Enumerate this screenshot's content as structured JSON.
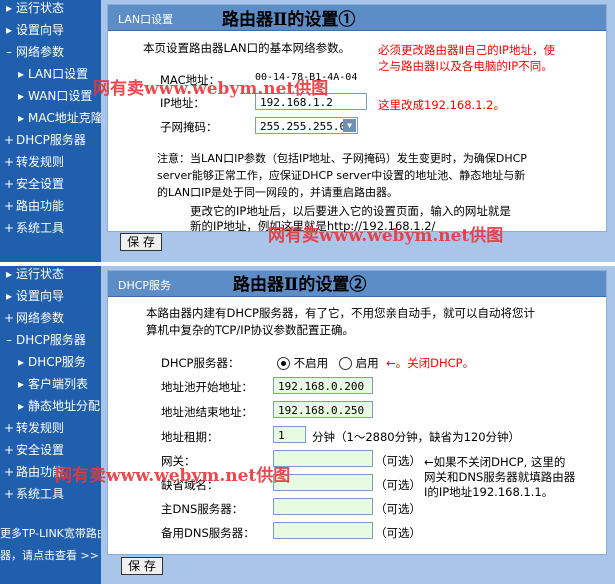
{
  "top": {
    "sidebar": [
      {
        "bullet": "▸",
        "label": "运行状态"
      },
      {
        "bullet": "▸",
        "label": "设置向导"
      },
      {
        "bullet": "–",
        "label": "网络参数"
      },
      {
        "bullet": "▸",
        "label": "LAN口设置"
      },
      {
        "bullet": "▸",
        "label": "WAN口设置"
      },
      {
        "bullet": "▸",
        "label": "MAC地址克隆"
      },
      {
        "bullet": "+",
        "label": "DHCP服务器"
      },
      {
        "bullet": "+",
        "label": "转发规则"
      },
      {
        "bullet": "+",
        "label": "安全设置"
      },
      {
        "bullet": "+",
        "label": "路由功能"
      },
      {
        "bullet": "+",
        "label": "系统工具"
      }
    ],
    "section_label": "LAN口设置",
    "big_title": "路由器Ⅱ的设置①",
    "intro": "本页设置路由器LAN口的基本网络参数。",
    "mac_label": "MAC地址：",
    "mac_value": "00-14-78-B1-4A-04",
    "ip_label": "IP地址：",
    "ip_value": "192.168.1.2",
    "mask_label": "子网掩码：",
    "mask_value": "255.255.255.0",
    "annot_red_1": "必须更改路由器Ⅱ自己的IP地址，使",
    "annot_red_2": "之与路由器Ⅰ以及各电脑的IP不同。",
    "annot_red_3": "这里改成192.168.1.2。",
    "note_1": "注意：当LAN口IP参数（包括IP地址、子网掩码）发生变更时，为确保DHCP",
    "note_2": "server能够正常工作，应保证DHCP server中设置的地址池、静态地址与新",
    "note_3": "的LAN口IP是处于同一网段的，并请重启路由器。",
    "note_4": "更改它的IP地址后，以后要进入它的设置页面，输入的网址就是",
    "note_5": "新的IP地址，例如这里就是http://192.168.1.2/",
    "save_label": "保 存"
  },
  "bottom": {
    "sidebar": [
      {
        "bullet": "▸",
        "label": "运行状态"
      },
      {
        "bullet": "▸",
        "label": "设置向导"
      },
      {
        "bullet": "+",
        "label": "网络参数"
      },
      {
        "bullet": "–",
        "label": "DHCP服务器"
      },
      {
        "bullet": "▸",
        "label": "DHCP服务"
      },
      {
        "bullet": "▸",
        "label": "客户端列表"
      },
      {
        "bullet": "▸",
        "label": "静态地址分配"
      },
      {
        "bullet": "+",
        "label": "转发规则"
      },
      {
        "bullet": "+",
        "label": "安全设置"
      },
      {
        "bullet": "+",
        "label": "路由功能"
      },
      {
        "bullet": "+",
        "label": "系统工具"
      }
    ],
    "more_1": "更多TP-LINK宽带路由",
    "more_2": "器，请点击查看 >>",
    "section_label": "DHCP服务",
    "big_title": "路由器Ⅱ的设置②",
    "intro_1": "本路由器内建有DHCP服务器，有了它，不用您亲自动手，就可以自动将您计",
    "intro_2": "算机中复杂的TCP/IP协议参数配置正确。",
    "dhcp_label": "DHCP服务器：",
    "opt_disable": "不启用",
    "opt_enable": "启用",
    "annot_dhcp": "←。关闭DHCP。",
    "pool_start_label": "地址池开始地址：",
    "pool_start_value": "192.168.0.200",
    "pool_end_label": "地址池结束地址：",
    "pool_end_value": "192.168.0.250",
    "lease_label": "地址租期：",
    "lease_value": "1",
    "lease_unit": "分钟（1～2880分钟，缺省为120分钟）",
    "gateway_label": "网关：",
    "domain_label": "缺省域名：",
    "dns1_label": "主DNS服务器：",
    "dns2_label": "备用DNS服务器：",
    "optional": "（可选）",
    "annot_gw_1": "←如果不关闭DHCP, 这里的",
    "annot_gw_2": "网关和DNS服务器就填路由器",
    "annot_gw_3": "Ⅰ的IP地址192.168.1.1。",
    "save_label": "保 存"
  },
  "watermark": "网有卖www.webym.net供图"
}
